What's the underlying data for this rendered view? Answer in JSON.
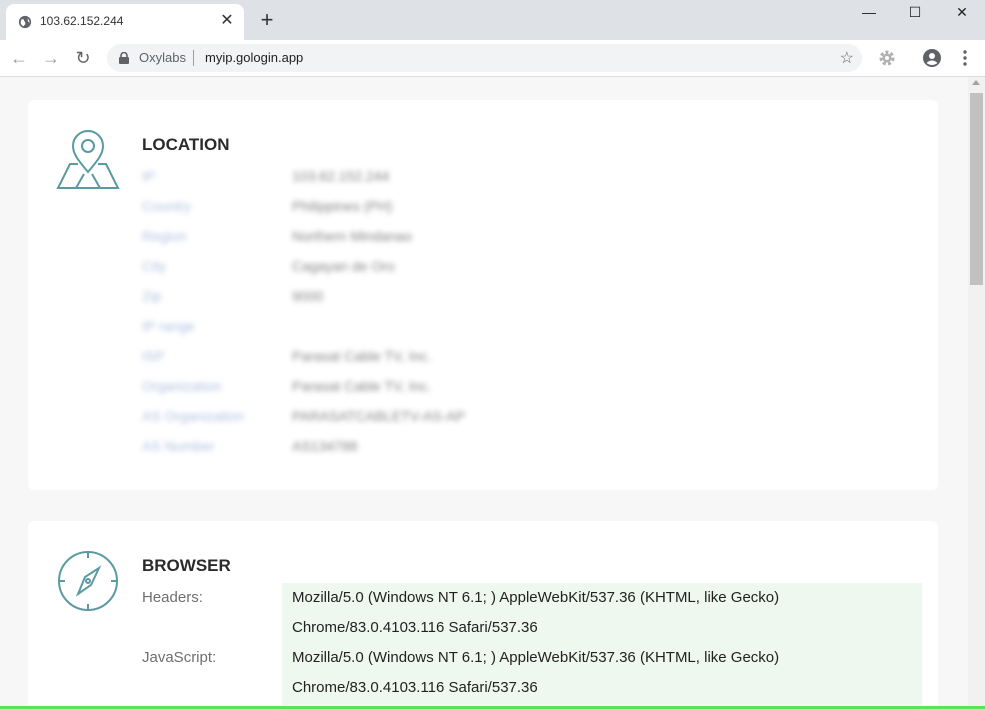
{
  "tab": {
    "title": "103.62.152.244",
    "close": "✕",
    "new_tab": "+"
  },
  "window": {
    "minimize": "—",
    "maximize": "☐",
    "close": "✕"
  },
  "toolbar": {
    "back": "←",
    "forward": "→",
    "reload": "↻",
    "site_name": "Oxylabs",
    "url": "myip.gologin.app",
    "star": "☆"
  },
  "location": {
    "title": "LOCATION",
    "rows": [
      {
        "label": "IP",
        "value": "103.62.152.244"
      },
      {
        "label": "Country",
        "value": "Philippines (PH)"
      },
      {
        "label": "Region",
        "value": "Northern Mindanao"
      },
      {
        "label": "City",
        "value": "Cagayan de Oro"
      },
      {
        "label": "Zip",
        "value": "9000"
      },
      {
        "label": "IP range",
        "value": ""
      },
      {
        "label": "ISP",
        "value": "Parasat Cable TV, Inc."
      },
      {
        "label": "Organization",
        "value": "Parasat Cable TV, Inc."
      },
      {
        "label": "AS Organization",
        "value": "PARASATCABLETV-AS-AP"
      },
      {
        "label": "AS Number",
        "value": "AS134788"
      }
    ]
  },
  "browser": {
    "title": "BROWSER",
    "headers_label": "Headers:",
    "headers_line1": "Mozilla/5.0 (Windows NT 6.1; ) AppleWebKit/537.36 (KHTML, like Gecko)",
    "headers_line2": "Chrome/83.0.4103.116 Safari/537.36",
    "js_label": "JavaScript:",
    "js_line1": "Mozilla/5.0 (Windows NT 6.1; ) AppleWebKit/537.36 (KHTML, like Gecko)",
    "js_line2": "Chrome/83.0.4103.116 Safari/537.36"
  },
  "colors": {
    "accent_icon": "#5a9aa0",
    "ua_bg": "#eef8ee",
    "progress": "#5ee05e"
  }
}
